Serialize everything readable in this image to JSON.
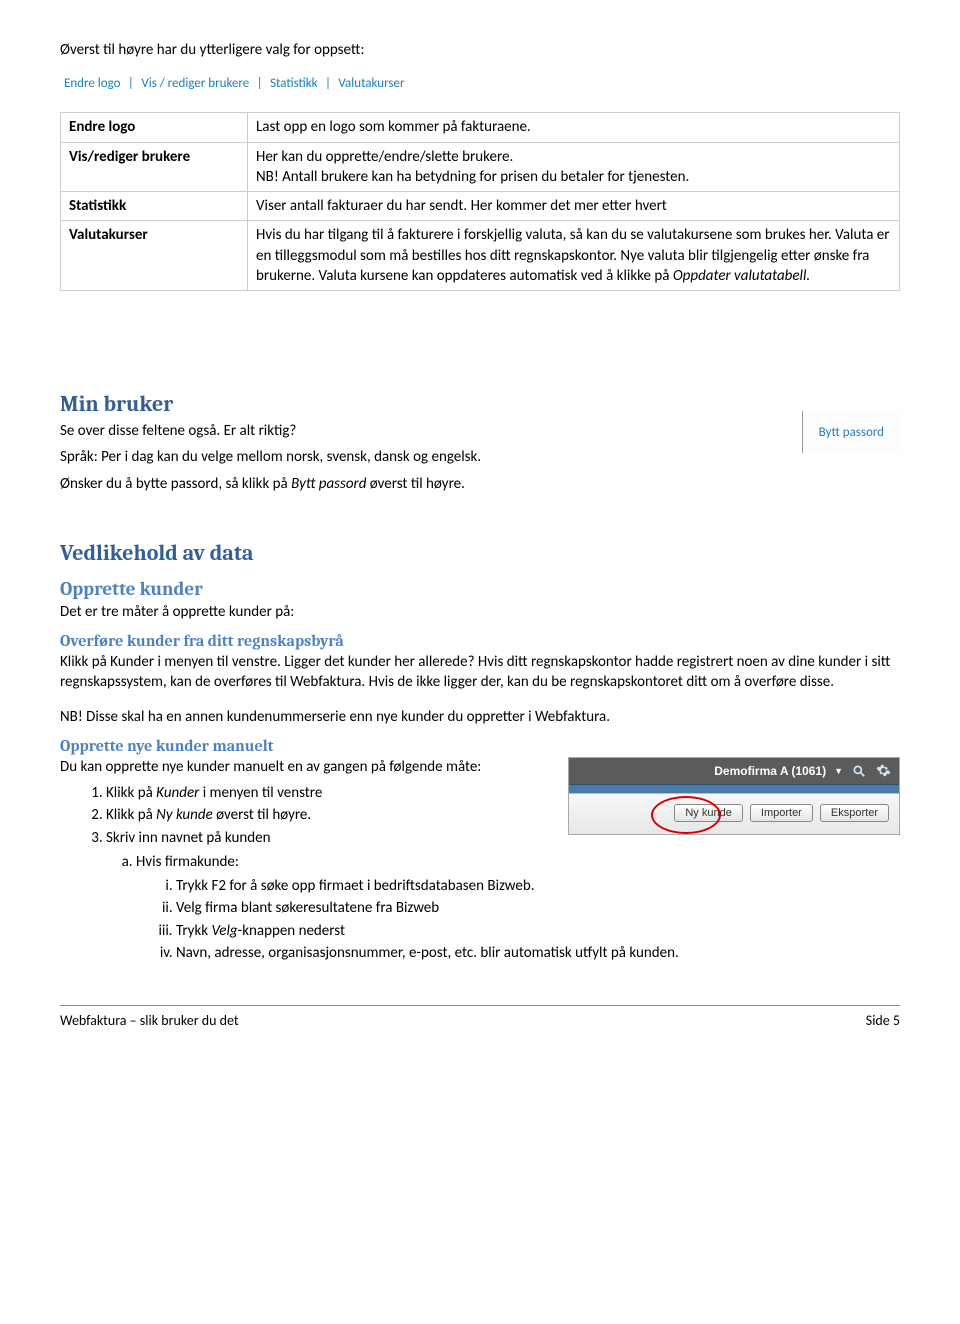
{
  "intro": "Øverst til høyre har du ytterligere valg for oppsett:",
  "nav": {
    "items": [
      "Endre logo",
      "Vis / rediger brukere",
      "Statistikk",
      "Valutakurser"
    ]
  },
  "table": {
    "rows": [
      {
        "label": "Endre logo",
        "text": "Last opp en logo som kommer på fakturaene."
      },
      {
        "label": "Vis/rediger brukere",
        "text": "Her kan du opprette/endre/slette brukere.\nNB! Antall brukere kan ha betydning for prisen du betaler for tjenesten."
      },
      {
        "label": "Statistikk",
        "text": "Viser antall fakturaer du har sendt. Her kommer det mer etter hvert"
      },
      {
        "label": "Valutakurser",
        "text": "Hvis du har tilgang til å fakturere i forskjellig valuta, så kan du se valutakursene som brukes her. Valuta er en tilleggsmodul som må bestilles hos ditt regnskapskontor. Nye valuta blir tilgjengelig etter ønske fra brukerne. Valuta kursene kan oppdateres automatisk ved å klikke på ",
        "italic_suffix": "Oppdater valutatabell."
      }
    ]
  },
  "min_bruker": {
    "heading": "Min bruker",
    "p1": "Se over disse feltene også. Er alt riktig?",
    "p2": "Språk: Per i dag kan du velge mellom norsk, svensk, dansk og engelsk.",
    "p3_a": "Ønsker du å bytte passord, så klikk på ",
    "p3_i": "Bytt passord",
    "p3_b": " øverst til høyre.",
    "bytt_link": "Bytt passord"
  },
  "vedlikehold": {
    "heading": "Vedlikehold av data",
    "opprette_heading": "Opprette kunder",
    "opprette_intro": "Det er tre måter å opprette kunder på:",
    "overfore_heading": "Overføre kunder fra ditt regnskapsbyrå",
    "overfore_p": "Klikk på Kunder i menyen til venstre. Ligger det kunder her allerede? Hvis ditt regnskapskontor hadde registrert noen av dine kunder i sitt regnskapssystem, kan de overføres til Webfaktura. Hvis de ikke ligger der, kan du be regnskapskontoret ditt om å overføre disse.",
    "nb_line": "NB! Disse skal ha en annen kundenummerserie enn nye kunder du oppretter i Webfaktura.",
    "manuelt_heading": "Opprette nye kunder manuelt",
    "manuelt_intro": "Du kan opprette nye kunder manuelt en av gangen på følgende måte:",
    "steps": {
      "s1_a": "Klikk på ",
      "s1_i": "Kunder",
      "s1_b": " i menyen til venstre",
      "s2_a": "Klikk på ",
      "s2_i": "Ny kunde",
      "s2_b": " øverst til høyre.",
      "s3": "Skriv inn navnet på kunden",
      "s3a": "Hvis firmakunde:",
      "s3ai": "Trykk F2 for å søke opp firmaet i bedriftsdatabasen Bizweb.",
      "s3aii": "Velg firma blant søkeresultatene fra Bizweb",
      "s3aiii_a": "Trykk ",
      "s3aiii_i": "Velg",
      "s3aiii_b": "-knappen nederst",
      "s3aiv": "Navn, adresse, organisasjonsnummer, e-post, etc. blir automatisk utfylt på kunden."
    },
    "toolbar": {
      "title": "Demofirma A (1061)",
      "btn1": "Ny kunde",
      "btn2": "Importer",
      "btn3": "Eksporter"
    }
  },
  "footer": {
    "left": "Webfaktura – slik bruker du det",
    "right": "Side 5"
  }
}
